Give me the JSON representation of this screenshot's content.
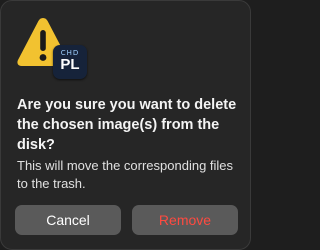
{
  "dialog": {
    "icon": {
      "warning": "warning-triangle-icon",
      "app_badge_top": "CHD",
      "app_badge_main": "PL"
    },
    "title": "Are you sure you want to delete the chosen image(s) from the disk?",
    "message": "This will move the corresponding files to the trash.",
    "buttons": {
      "cancel": "Cancel",
      "remove": "Remove"
    },
    "colors": {
      "background": "#262626",
      "warning_yellow": "#f2c230",
      "destructive": "#ff4a40",
      "button_bg": "#5a5a5a"
    }
  }
}
